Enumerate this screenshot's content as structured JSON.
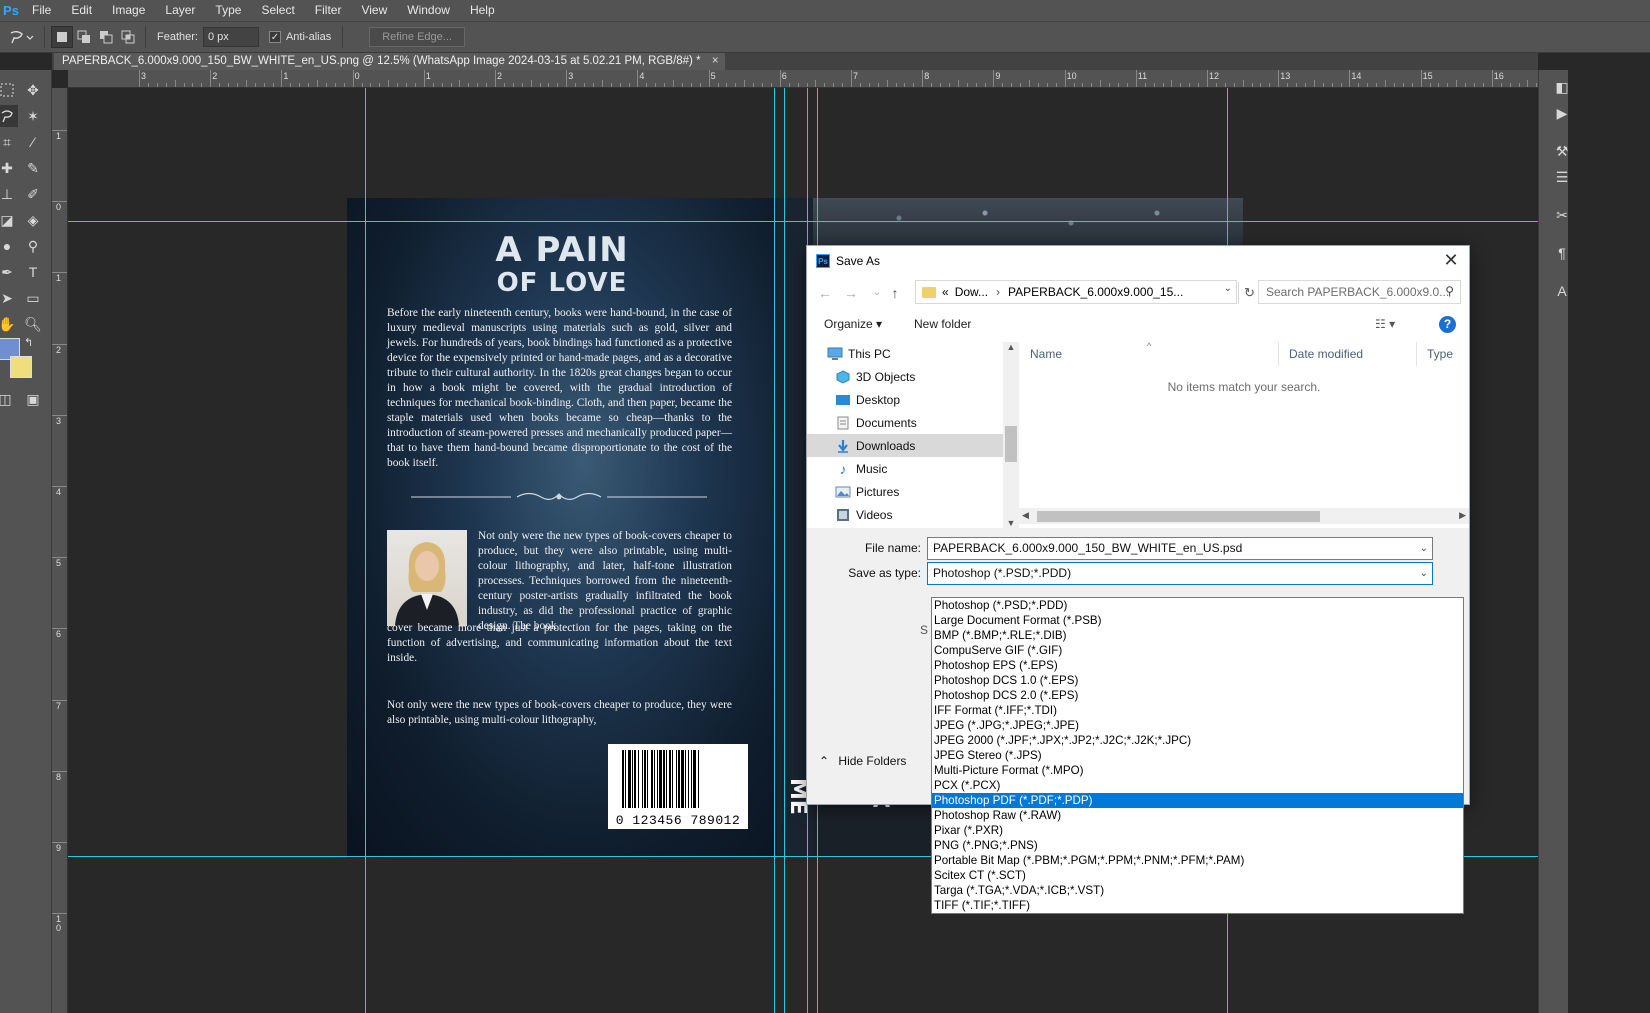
{
  "menubar": {
    "logo": "Ps",
    "items": [
      "File",
      "Edit",
      "Image",
      "Layer",
      "Type",
      "Select",
      "Filter",
      "View",
      "Window",
      "Help"
    ]
  },
  "options": {
    "feather_label": "Feather:",
    "feather_value": "0 px",
    "antialias_label": "Anti-alias",
    "refine_label": "Refine Edge..."
  },
  "document": {
    "tab_title": "PAPERBACK_6.000x9.000_150_BW_WHITE_en_US.png @ 12.5% (WhatsApp Image 2024-03-15 at 5.02.21 PM, RGB/8#) *",
    "close": "×"
  },
  "rulers": {
    "h": [
      "3",
      "2",
      "1",
      "0",
      "1",
      "2",
      "3",
      "4",
      "5",
      "6",
      "7",
      "8",
      "9",
      "10",
      "11",
      "12",
      "13",
      "14",
      "15",
      "16"
    ],
    "v": [
      "1",
      "0",
      "1",
      "2",
      "3",
      "4",
      "5",
      "6",
      "7",
      "8",
      "9",
      "1\n0"
    ]
  },
  "cover": {
    "title_line1": "A PAIN",
    "title_line2": "OF LOVE",
    "para1": "Before the early nineteenth century, books were hand-bound, in the case of luxury medieval manuscripts using materials such as gold, silver and jewels. For hundreds of years, book bindings had functioned as a protective device for the expensively printed or hand-made pages, and as a decorative tribute to their cultural authority. In the 1820s great changes began to occur in how a book might be covered, with the gradual introduction of techniques for mechanical book-binding. Cloth, and then paper, became the staple materials used when books became so cheap—thanks to the introduction of steam-powered presses and mechanically produced paper—that to have them hand-bound became disproportionate to the cost of the book itself.",
    "para2": "Not only were the new types of book-covers cheaper to produce, but they were also printable, using multi-colour lithography, and later, half-tone illustration processes. Techniques borrowed from the nineteenth-century poster-artists gradually infiltrated the book industry, as did the professional practice of graphic design. The book",
    "para3": "cover became more than just a protection for the pages, taking on the function of advertising, and communicating information about the text inside.",
    "para4": "Not only were the new types of book-covers cheaper to produce, they were also printable, using multi-colour lithography,",
    "barcode_number": "0 123456 789012",
    "spine_text": "ME",
    "front_letter": "A"
  },
  "dialog": {
    "title": "Save As",
    "close": "✕",
    "address": {
      "prefix": "«",
      "part1": "Dow...",
      "sep": "›",
      "part2": "PAPERBACK_6.000x9.000_15..."
    },
    "search_placeholder": "Search PAPERBACK_6.000x9.0...",
    "organize": "Organize ▾",
    "new_folder": "New folder",
    "help": "?",
    "nav_items": [
      {
        "label": "This PC",
        "icon": "computer-icon"
      },
      {
        "label": "3D Objects",
        "icon": "3d-objects-icon"
      },
      {
        "label": "Desktop",
        "icon": "desktop-icon"
      },
      {
        "label": "Documents",
        "icon": "documents-icon"
      },
      {
        "label": "Downloads",
        "icon": "downloads-icon"
      },
      {
        "label": "Music",
        "icon": "music-icon"
      },
      {
        "label": "Pictures",
        "icon": "pictures-icon"
      },
      {
        "label": "Videos",
        "icon": "videos-icon"
      }
    ],
    "columns": [
      "Name",
      "Date modified",
      "Type"
    ],
    "empty_message": "No items match your search.",
    "file_name_label": "File name:",
    "file_name_value": "PAPERBACK_6.000x9.000_150_BW_WHITE_en_US.psd",
    "save_type_label": "Save as type:",
    "save_type_value": "Photoshop (*.PSD;*.PDD)",
    "hide_folders": "Hide Folders",
    "partial_letter": "S"
  },
  "dropdown": {
    "selected_index": 13,
    "options": [
      "Photoshop (*.PSD;*.PDD)",
      "Large Document Format (*.PSB)",
      "BMP (*.BMP;*.RLE;*.DIB)",
      "CompuServe GIF (*.GIF)",
      "Photoshop EPS (*.EPS)",
      "Photoshop DCS 1.0 (*.EPS)",
      "Photoshop DCS 2.0 (*.EPS)",
      "IFF Format (*.IFF;*.TDI)",
      "JPEG (*.JPG;*.JPEG;*.JPE)",
      "JPEG 2000 (*.JPF;*.JPX;*.JP2;*.J2C;*.J2K;*.JPC)",
      "JPEG Stereo (*.JPS)",
      "Multi-Picture Format (*.MPO)",
      "PCX (*.PCX)",
      "Photoshop PDF (*.PDF;*.PDP)",
      "Photoshop Raw (*.RAW)",
      "Pixar (*.PXR)",
      "PNG (*.PNG;*.PNS)",
      "Portable Bit Map (*.PBM;*.PGM;*.PPM;*.PNM;*.PFM;*.PAM)",
      "Scitex CT (*.SCT)",
      "Targa (*.TGA;*.VDA;*.ICB;*.VST)",
      "TIFF (*.TIF;*.TIFF)"
    ]
  },
  "colors": {
    "guide": "#2ec7e0",
    "foreground_swatch": "#6f8fd0",
    "background_swatch": "#f0de7a",
    "selection": "#0078d7"
  }
}
